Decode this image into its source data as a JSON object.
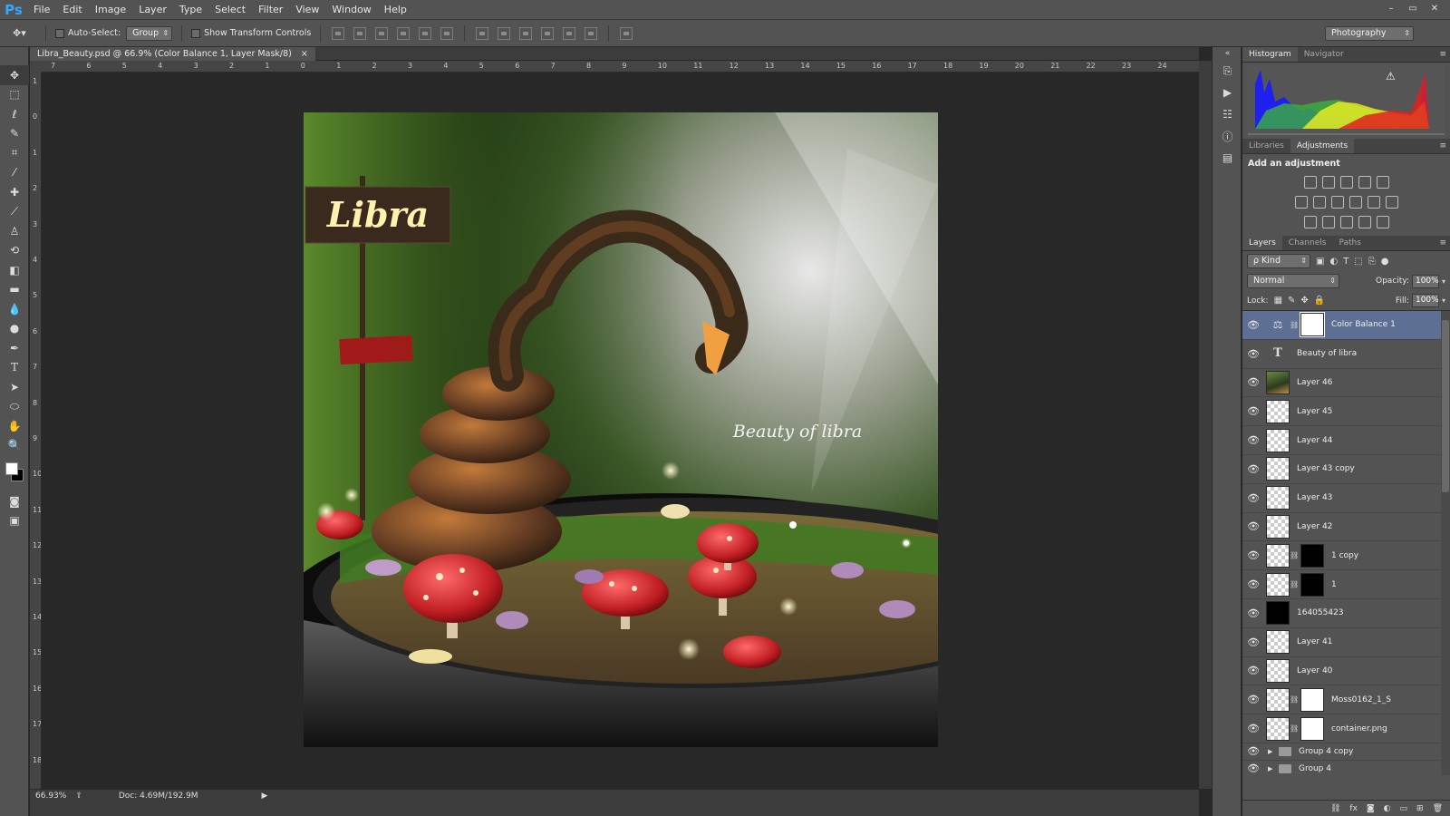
{
  "app": {
    "logo": "Ps"
  },
  "menu": [
    "File",
    "Edit",
    "Image",
    "Layer",
    "Type",
    "Select",
    "Filter",
    "View",
    "Window",
    "Help"
  ],
  "window_controls": [
    "–",
    "▭",
    "✕"
  ],
  "options_bar": {
    "auto_select_label": "Auto-Select:",
    "auto_select_value": "Group",
    "show_transform_label": "Show Transform Controls",
    "workspace": "Photography"
  },
  "document": {
    "tab_title": "Libra_Beauty.psd @ 66.9% (Color Balance 1, Layer Mask/8)",
    "tab_close": "×",
    "art_sign_text": "Libra",
    "art_caption": "Beauty of libra"
  },
  "rulers": {
    "h_labels": [
      "7",
      "6",
      "5",
      "4",
      "3",
      "2",
      "1",
      "0",
      "1",
      "2",
      "3",
      "4",
      "5",
      "6",
      "7",
      "8",
      "9",
      "10",
      "11",
      "12",
      "13",
      "14",
      "15",
      "16",
      "17",
      "18",
      "19",
      "20",
      "21",
      "22",
      "23",
      "24"
    ],
    "v_labels": [
      "1",
      "0",
      "1",
      "2",
      "3",
      "4",
      "5",
      "6",
      "7",
      "8",
      "9",
      "10",
      "11",
      "12",
      "13",
      "14",
      "15",
      "16",
      "17",
      "18"
    ]
  },
  "status": {
    "zoom": "66.93%",
    "doc": "Doc: 4.69M/192.9M"
  },
  "panels": {
    "histogram_tabs": [
      "Histogram",
      "Navigator"
    ],
    "adjust_tabs": [
      "Libraries",
      "Adjustments"
    ],
    "adjust_title": "Add an adjustment",
    "layers_tabs": [
      "Layers",
      "Channels",
      "Paths"
    ],
    "kind_label": "ρ Kind",
    "blend_mode": "Normal",
    "opacity_label": "Opacity:",
    "opacity_value": "100%",
    "lock_label": "Lock:",
    "fill_label": "Fill:",
    "fill_value": "100%"
  },
  "layers": [
    {
      "name": "Color Balance 1",
      "thumb": "adj",
      "mask": true,
      "selected": true
    },
    {
      "name": "Beauty of libra",
      "thumb": "type",
      "mask": false
    },
    {
      "name": "Layer 46",
      "thumb": "photo",
      "mask": false
    },
    {
      "name": "Layer 45",
      "thumb": "trans",
      "mask": false
    },
    {
      "name": "Layer 44",
      "thumb": "trans",
      "mask": false
    },
    {
      "name": "Layer 43 copy",
      "thumb": "trans",
      "mask": false
    },
    {
      "name": "Layer 43",
      "thumb": "trans",
      "mask": false
    },
    {
      "name": "Layer 42",
      "thumb": "trans",
      "mask": false
    },
    {
      "name": "1 copy",
      "thumb": "trans",
      "mask": true,
      "maskBlack": true
    },
    {
      "name": "1",
      "thumb": "trans",
      "mask": true,
      "maskBlack": true
    },
    {
      "name": "164055423",
      "thumb": "black",
      "mask": false
    },
    {
      "name": "Layer 41",
      "thumb": "trans",
      "mask": false
    },
    {
      "name": "Layer 40",
      "thumb": "trans",
      "mask": false
    },
    {
      "name": "Moss0162_1_S",
      "thumb": "trans",
      "mask": true
    },
    {
      "name": "container.png",
      "thumb": "trans",
      "mask": true
    },
    {
      "name": "Group 4 copy",
      "group": true
    },
    {
      "name": "Group 4",
      "group": true
    }
  ],
  "colors": {
    "accent": "#31a8ff",
    "selected_layer": "#5d6f93",
    "panel_bg": "#535353",
    "canvas_bg": "#282828"
  }
}
